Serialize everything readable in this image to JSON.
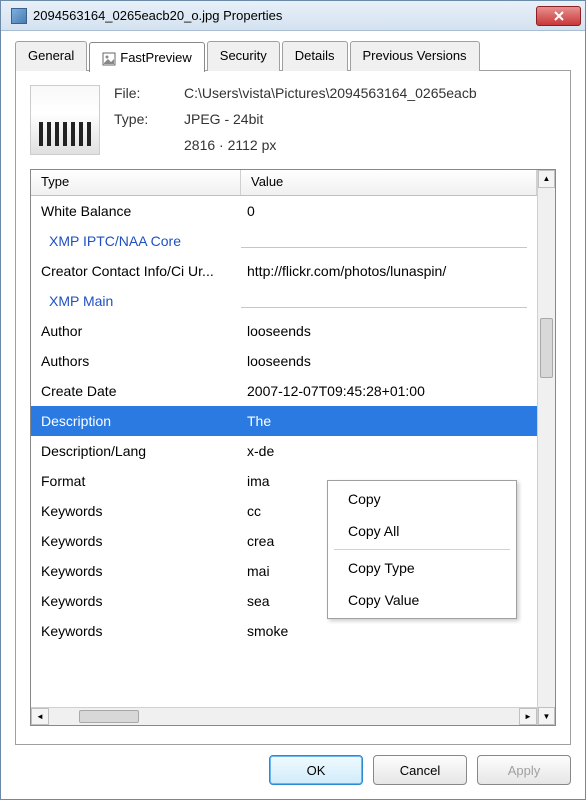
{
  "title": "2094563164_0265eacb20_o.jpg Properties",
  "tabs": {
    "general": "General",
    "fastpreview": "FastPreview",
    "security": "Security",
    "details": "Details",
    "previous": "Previous Versions"
  },
  "file_info": {
    "file_label": "File:",
    "file_value": "C:\\Users\\vista\\Pictures\\2094563164_0265eacb",
    "type_label": "Type:",
    "type_value": "JPEG - 24bit",
    "dims": "2816 · 2112 px"
  },
  "columns": {
    "type": "Type",
    "value": "Value"
  },
  "rows": [
    {
      "t": "White Balance",
      "v": "0",
      "kind": "item"
    },
    {
      "t": "XMP IPTC/NAA Core",
      "v": "",
      "kind": "section"
    },
    {
      "t": "Creator Contact Info/Ci Ur...",
      "v": "http://flickr.com/photos/lunaspin/",
      "kind": "item"
    },
    {
      "t": "XMP Main",
      "v": "",
      "kind": "section"
    },
    {
      "t": "Author",
      "v": "looseends",
      "kind": "item"
    },
    {
      "t": "Authors",
      "v": "looseends",
      "kind": "item"
    },
    {
      "t": "Create Date",
      "v": "2007-12-07T09:45:28+01:00",
      "kind": "item"
    },
    {
      "t": "Description",
      "v": "The",
      "kind": "selected"
    },
    {
      "t": "Description/Lang",
      "v": "x-de",
      "kind": "item"
    },
    {
      "t": "Format",
      "v": "ima",
      "kind": "item"
    },
    {
      "t": "Keywords",
      "v": "cc",
      "kind": "item"
    },
    {
      "t": "Keywords",
      "v": "crea",
      "kind": "item"
    },
    {
      "t": "Keywords",
      "v": "mai",
      "kind": "item"
    },
    {
      "t": "Keywords",
      "v": "sea",
      "kind": "item"
    },
    {
      "t": "Keywords",
      "v": "smoke",
      "kind": "item"
    }
  ],
  "context_menu": {
    "copy": "Copy",
    "copy_all": "Copy All",
    "copy_type": "Copy Type",
    "copy_value": "Copy Value"
  },
  "buttons": {
    "ok": "OK",
    "cancel": "Cancel",
    "apply": "Apply"
  }
}
